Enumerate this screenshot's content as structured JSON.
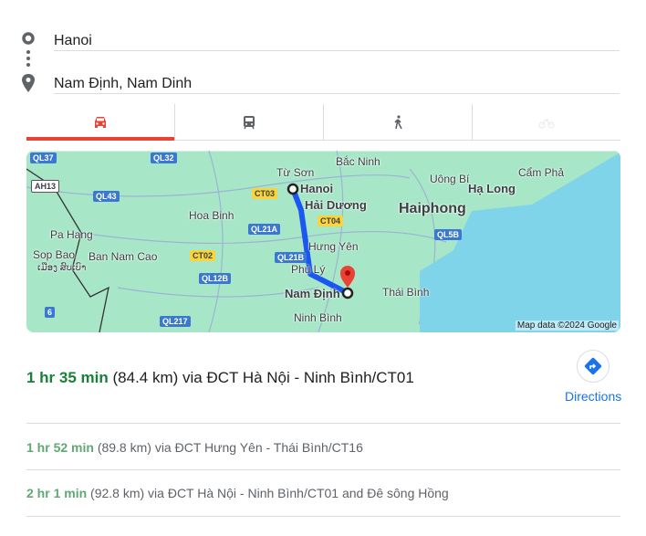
{
  "origin": {
    "value": "Hanoi",
    "icon": "origin-circle-icon"
  },
  "destination": {
    "value": "Nam Định, Nam Dinh",
    "icon": "destination-pin-icon"
  },
  "tabs": [
    {
      "name": "driving",
      "icon": "car-icon",
      "active": true
    },
    {
      "name": "transit",
      "icon": "train-icon",
      "active": false
    },
    {
      "name": "walking",
      "icon": "walk-icon",
      "active": false
    },
    {
      "name": "cycling",
      "icon": "bike-icon",
      "active": false,
      "disabled": true
    }
  ],
  "map": {
    "cities": {
      "tu_son": "Từ Sơn",
      "bac_ninh": "Bắc Ninh",
      "hanoi": "Hanoi",
      "hai_duong": "Hải Dương",
      "haiphong": "Haiphong",
      "uong_bi": "Uông Bí",
      "ha_long": "Hạ Long",
      "cam_pha": "Cẩm Phả",
      "hoa_binh": "Hoa Binh",
      "pa_hang": "Pa Hang",
      "sop_bao": "Sop Bao",
      "sop_bao_lao": "ເມືອງ ສົບເບົາ",
      "ban_nam_cao": "Ban Nam Cao",
      "hung_yen": "Hưng Yên",
      "phu_ly": "Phủ Lý",
      "nam_dinh": "Nam Định",
      "thai_binh": "Thái Bình",
      "ninh_binh": "Ninh Bình"
    },
    "shields": {
      "ql37": "QL37",
      "ql32": "QL32",
      "ah13": "AH13",
      "ql43": "QL43",
      "ct03": "CT03",
      "ct04": "CT04",
      "ql21a": "QL21A",
      "ct02": "CT02",
      "ql21b": "QL21B",
      "ql12b": "QL12B",
      "ql5b": "QL5B",
      "r6": "6",
      "ql217": "QL217"
    },
    "attribution": "Map data ©2024 Google",
    "route_color": "#1a56f0",
    "sea_color": "#7fd4ea",
    "land_color": "#a8e6c8"
  },
  "best_route": {
    "duration": "1 hr 35 min",
    "details": "(84.4 km) via ĐCT Hà Nội - Ninh Bình/CT01"
  },
  "directions_button": {
    "label": "Directions",
    "icon": "directions-diamond-icon",
    "color": "#1a73e8"
  },
  "alternatives": [
    {
      "duration": "1 hr 52 min",
      "details": "(89.8 km) via ĐCT Hưng Yên - Thái Bình/CT16"
    },
    {
      "duration": "2 hr 1 min",
      "details": "(92.8 km) via ĐCT Hà Nội - Ninh Bình/CT01 and Đê sông Hồng"
    }
  ]
}
